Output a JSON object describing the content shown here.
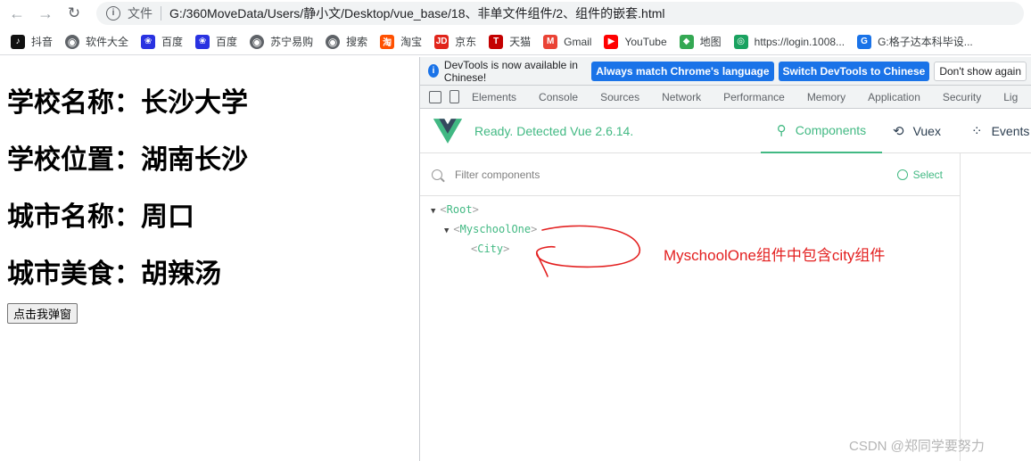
{
  "browser": {
    "scheme_label": "文件",
    "url": "G:/360MoveData/Users/静小文/Desktop/vue_base/18、非单文件组件/2、组件的嵌套.html"
  },
  "bookmarks": [
    {
      "label": "抖音",
      "icon": "douyin-icon",
      "color": "#111111",
      "glyph": "♪"
    },
    {
      "label": "软件大全",
      "icon": "globe-icon",
      "color": "#5f6368",
      "glyph": "◉"
    },
    {
      "label": "百度",
      "icon": "baidu-paw-icon",
      "color": "#2932e1",
      "glyph": "❀"
    },
    {
      "label": "百度",
      "icon": "baidu-paw-icon",
      "color": "#2932e1",
      "glyph": "❀"
    },
    {
      "label": "苏宁易购",
      "icon": "globe-icon",
      "color": "#5f6368",
      "glyph": "◉"
    },
    {
      "label": "搜索",
      "icon": "globe-icon",
      "color": "#5f6368",
      "glyph": "◉"
    },
    {
      "label": "淘宝",
      "icon": "taobao-icon",
      "color": "#ff5000",
      "glyph": "淘"
    },
    {
      "label": "京东",
      "icon": "jd-icon",
      "color": "#e1251b",
      "glyph": "JD"
    },
    {
      "label": "天猫",
      "icon": "tmall-icon",
      "color": "#c40000",
      "glyph": "T"
    },
    {
      "label": "Gmail",
      "icon": "gmail-icon",
      "color": "#ea4335",
      "glyph": "M"
    },
    {
      "label": "YouTube",
      "icon": "youtube-icon",
      "color": "#ff0000",
      "glyph": "▶"
    },
    {
      "label": "地图",
      "icon": "maps-icon",
      "color": "#34a853",
      "glyph": "◆"
    },
    {
      "label": "https://login.1008...",
      "icon": "china-mobile-icon",
      "color": "#1aa260",
      "glyph": "◎"
    },
    {
      "label": "G:格子达本科毕设...",
      "icon": "gezida-icon",
      "color": "#1a73e8",
      "glyph": "G"
    }
  ],
  "page": {
    "school_name": "学校名称：长沙大学",
    "school_location": "学校位置：湖南长沙",
    "city_name": "城市名称：周口",
    "city_food": "城市美食：胡辣汤",
    "popup_button": "点击我弹窗"
  },
  "devtools": {
    "infobar_message": "DevTools is now available in Chinese!",
    "match_language_button": "Always match Chrome's language",
    "switch_button": "Switch DevTools to Chinese",
    "dismiss_button": "Don't show again",
    "tabs": [
      "Elements",
      "Console",
      "Sources",
      "Network",
      "Performance",
      "Memory",
      "Application",
      "Security",
      "Lig"
    ]
  },
  "vue": {
    "status": "Ready. Detected Vue 2.6.14.",
    "tabs": [
      {
        "label": "Components",
        "icon": "components-icon",
        "active": true
      },
      {
        "label": "Vuex",
        "icon": "history-icon",
        "active": false
      },
      {
        "label": "Events",
        "icon": "events-icon",
        "active": false
      }
    ],
    "filter_placeholder": "Filter components",
    "select_label": "Select",
    "tree": {
      "root": "Root",
      "child": "MyschoolOne",
      "grandchild": "City"
    }
  },
  "annotation": "MyschoolOne组件中包含city组件",
  "watermark": "CSDN @郑同学要努力",
  "colors": {
    "vue_green": "#42b983",
    "annotation_red": "#e32020",
    "chrome_blue": "#1a73e8"
  }
}
